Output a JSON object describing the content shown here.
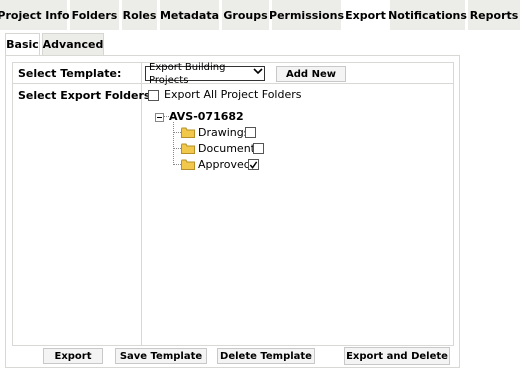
{
  "top_tabs": [
    "Project Info",
    "Folders",
    "Roles",
    "Metadata",
    "Groups",
    "Permissions",
    "Export",
    "Notifications",
    "Reports"
  ],
  "active_top_tab": "Export",
  "sub_tabs": [
    "Basic",
    "Advanced"
  ],
  "active_sub_tab": "Basic",
  "template": {
    "label": "Select Template:",
    "selected": "Export Building Projects",
    "add_new_label": "Add New"
  },
  "folders": {
    "label": "Select Export Folders:",
    "export_all_label": "Export All Project Folders",
    "export_all_checked": false,
    "root": "AVS-071682",
    "items": [
      {
        "name": "Drawings",
        "checked": false
      },
      {
        "name": "Documents",
        "checked": false
      },
      {
        "name": "Approved",
        "checked": true
      }
    ]
  },
  "actions": {
    "export": "Export",
    "save_template": "Save Template",
    "delete_template": "Delete Template",
    "export_and_delete": "Export and Delete"
  },
  "icons": {
    "folder": "folder-icon",
    "collapse": "tree-collapse-icon",
    "dropdown": "chevron-down-icon",
    "check": "checkmark-icon"
  },
  "colors": {
    "tab_bg": "#ecece8",
    "folder_yellow": "#f1c84b"
  }
}
